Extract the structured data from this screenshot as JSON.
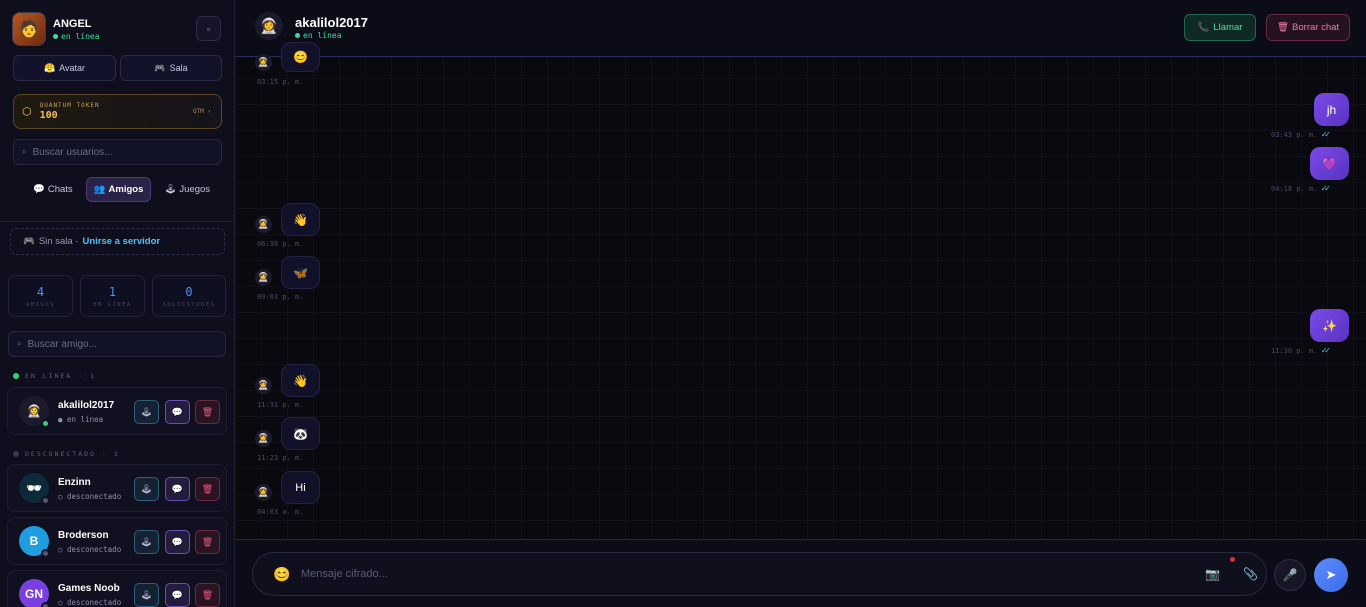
{
  "me": {
    "name": "ANGEL",
    "status": "en línea"
  },
  "sidebar": {
    "avatar_btn": "Avatar",
    "room_btn": "Sala",
    "token": {
      "label": "QUANTUM TOKEN",
      "value": "100",
      "unit": "QTM ›"
    },
    "search_users_placeholder": "Buscar usuarios...",
    "tabs": [
      {
        "icon": "💬",
        "label": "Chats"
      },
      {
        "icon": "👥",
        "label": "Amigos"
      },
      {
        "icon": "🕹",
        "label": "Juegos"
      }
    ],
    "room": {
      "no_room": "Sin sala ·",
      "join": "Unirse a servidor"
    },
    "stats": [
      {
        "value": "4",
        "label": "AMIGOS"
      },
      {
        "value": "1",
        "label": "EN LÍNEA"
      },
      {
        "value": "0",
        "label": "SOLICITUDES"
      }
    ],
    "search_friend_placeholder": "Buscar amigo...",
    "online_header": "EN LÍNEA · 1",
    "offline_header": "DESCONECTADO · 3",
    "friends": [
      {
        "name": "akalilol2017",
        "status": "● en línea",
        "initials": "",
        "color": "#1b1b2b"
      },
      {
        "name": "Enzinn",
        "status": "○ desconectado",
        "initials": "",
        "color": "#0d2a3a"
      },
      {
        "name": "Broderson",
        "status": "○ desconectado",
        "initials": "B",
        "color": "#1e9de0"
      },
      {
        "name": "Games Noob",
        "status": "○ desconectado",
        "initials": "GN",
        "color": "#7a3fe0"
      }
    ]
  },
  "chat": {
    "contact_name": "akalilol2017",
    "contact_status": "en línea",
    "call_btn": "Llamar",
    "clear_btn": "Borrar chat",
    "messages": [
      {
        "dir": "in",
        "content": "😊",
        "time": "03:15 p. m."
      },
      {
        "dir": "out",
        "content": "jh",
        "time": "03:43 p. m."
      },
      {
        "dir": "out",
        "content": "💜",
        "time": "04:18 p. m."
      },
      {
        "dir": "in",
        "content": "👋",
        "time": "06:38 p. m."
      },
      {
        "dir": "in",
        "content": "🦋",
        "time": "09:03 p. m."
      },
      {
        "dir": "out",
        "content": "✨",
        "time": "11:30 p. m."
      },
      {
        "dir": "in",
        "content": "👋",
        "time": "11:31 p. m."
      },
      {
        "dir": "in",
        "content": "🐼",
        "time": "11:23 p. m."
      },
      {
        "dir": "in",
        "content": "Hi",
        "time": "04:03 a. m."
      }
    ],
    "composer_placeholder": "Mensaje cifrado..."
  }
}
